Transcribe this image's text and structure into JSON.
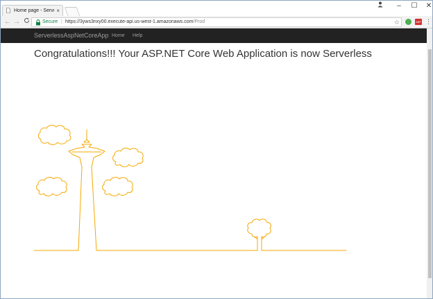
{
  "browser": {
    "tab_title": "Home page - Serverless",
    "tab_close": "×",
    "window_controls": {
      "user": "👤",
      "minimize": "–",
      "maximize": "☐",
      "close": "✕"
    },
    "nav": {
      "back": "←",
      "forward": "→",
      "reload": "C"
    },
    "omnibox": {
      "secure_label": "Secure",
      "separator": "|",
      "url_host": "https://3yws3nxy00.execute-api.us-west-1.amazonaws.com",
      "url_path": "/Prod",
      "star": "☆"
    },
    "menu": "⋮",
    "extension2_label": "ABP"
  },
  "site": {
    "brand": "ServerlessAspNetCoreApp",
    "nav_links": [
      "Home",
      "Help"
    ],
    "headline": "Congratulations!!! Your ASP.NET Core Web Application is now Serverless"
  },
  "art": {
    "stroke_color": "#f5a800",
    "description_icons": [
      "cloud-icon",
      "space-needle-icon",
      "tree-icon"
    ]
  }
}
